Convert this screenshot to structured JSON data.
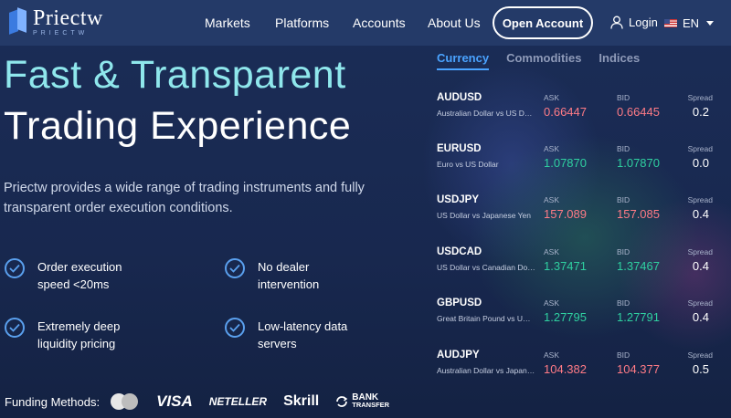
{
  "brand": {
    "name": "Priectw",
    "sub": "PRIECTW"
  },
  "nav": {
    "links": [
      "Markets",
      "Platforms",
      "Accounts",
      "About Us"
    ],
    "open_account": "Open Account",
    "login": "Login",
    "language": "EN"
  },
  "hero": {
    "title_line1": "Fast & Transparent",
    "title_line2": "Trading Experience",
    "description": "Priectw provides a wide range of trading instruments and fully transparent order execution conditions."
  },
  "features": [
    "Order execution speed <20ms",
    "No dealer intervention",
    "Extremely deep liquidity pricing",
    "Low-latency data servers"
  ],
  "funding": {
    "label": "Funding Methods:",
    "methods": [
      "VISA",
      "NETELLER",
      "Skrill"
    ],
    "bank_line1": "BANK",
    "bank_line2": "TRANSFER"
  },
  "quote_tabs": [
    "Currency",
    "Commodities",
    "Indices"
  ],
  "quote_labels": {
    "ask": "ASK",
    "bid": "BID",
    "spread": "Spread"
  },
  "quotes": [
    {
      "symbol": "AUDUSD",
      "name": "Australian Dollar vs US Dollar",
      "ask": "0.66447",
      "bid": "0.66445",
      "spread": "0.2",
      "direction": "down"
    },
    {
      "symbol": "EURUSD",
      "name": "Euro vs US Dollar",
      "ask": "1.07870",
      "bid": "1.07870",
      "spread": "0.0",
      "direction": "up"
    },
    {
      "symbol": "USDJPY",
      "name": "US Dollar vs Japanese Yen",
      "ask": "157.089",
      "bid": "157.085",
      "spread": "0.4",
      "direction": "down"
    },
    {
      "symbol": "USDCAD",
      "name": "US Dollar vs Canadian Dollar",
      "ask": "1.37471",
      "bid": "1.37467",
      "spread": "0.4",
      "direction": "up"
    },
    {
      "symbol": "GBPUSD",
      "name": "Great Britain Pound vs US Dollar",
      "ask": "1.27795",
      "bid": "1.27791",
      "spread": "0.4",
      "direction": "up"
    },
    {
      "symbol": "AUDJPY",
      "name": "Australian Dollar vs Japanese Yen",
      "ask": "104.382",
      "bid": "104.377",
      "spread": "0.5",
      "direction": "down"
    }
  ],
  "colors": {
    "up": "#2fd0a0",
    "down": "#ff7b86",
    "accent": "#4aa3ff",
    "title": "#8fe7ec"
  }
}
